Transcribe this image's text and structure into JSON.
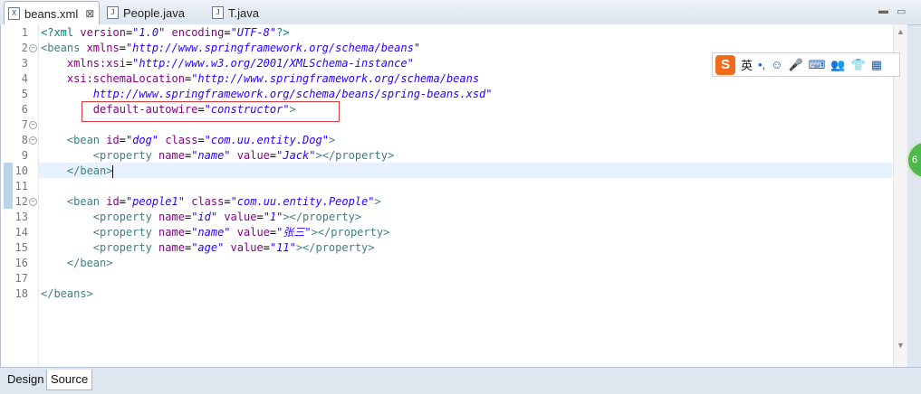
{
  "tabs": [
    {
      "label": "beans.xml",
      "icon": "xml-file-icon",
      "glyph": "X",
      "active": true
    },
    {
      "label": "People.java",
      "icon": "java-file-icon",
      "glyph": "J",
      "active": false
    },
    {
      "label": "T.java",
      "icon": "java-file-icon",
      "glyph": "J",
      "active": false
    }
  ],
  "window_buttons": {
    "minimize": "▬",
    "maximize": "▭"
  },
  "editor": {
    "lines": [
      {
        "n": "1",
        "fold": ""
      },
      {
        "n": "2",
        "fold": "−"
      },
      {
        "n": "3",
        "fold": ""
      },
      {
        "n": "4",
        "fold": ""
      },
      {
        "n": "5",
        "fold": ""
      },
      {
        "n": "6",
        "fold": ""
      },
      {
        "n": "7",
        "fold": "−"
      },
      {
        "n": "8",
        "fold": "−"
      },
      {
        "n": "9",
        "fold": ""
      },
      {
        "n": "10",
        "fold": ""
      },
      {
        "n": "11",
        "fold": ""
      },
      {
        "n": "12",
        "fold": "−"
      },
      {
        "n": "13",
        "fold": ""
      },
      {
        "n": "14",
        "fold": ""
      },
      {
        "n": "15",
        "fold": ""
      },
      {
        "n": "16",
        "fold": ""
      },
      {
        "n": "17",
        "fold": ""
      },
      {
        "n": "18",
        "fold": ""
      }
    ],
    "code": {
      "l1": {
        "p1": "<?xml ",
        "a1": "version",
        "eq1": "=",
        "v1": "\"1.0\"",
        "sp": " ",
        "a2": "encoding",
        "eq2": "=",
        "v2": "\"UTF-8\"",
        "p2": "?>"
      },
      "l2": {
        "t1": "<beans ",
        "a1": "xmlns",
        "eq": "=",
        "v1": "\"http://www.springframework.org/schema/beans\""
      },
      "l3": {
        "indent": "    ",
        "a1": "xmlns:xsi",
        "eq": "=",
        "v1": "\"http://www.w3.org/2001/XMLSchema-instance\""
      },
      "l4": {
        "indent": "    ",
        "a1": "xsi:schemaLocation",
        "eq": "=",
        "v1": "\"http://www.springframework.org/schema/beans"
      },
      "l5": {
        "indent": "        ",
        "v1": "http://www.springframework.org/schema/beans/spring-beans.xsd\""
      },
      "l6": {
        "indent": "        ",
        "a1": "default-autowire",
        "eq": "=",
        "v1": "\"constructor\"",
        "t1": ">"
      },
      "l8": {
        "indent": "    ",
        "t1": "<bean ",
        "a1": "id",
        "eq1": "=",
        "v1": "\"dog\"",
        "sp": " ",
        "a2": "class",
        "eq2": "=",
        "v2": "\"com.uu.entity.Dog\"",
        "t2": ">"
      },
      "l9": {
        "indent": "        ",
        "t1": "<property ",
        "a1": "name",
        "eq1": "=",
        "v1": "\"name\"",
        "sp": " ",
        "a2": "value",
        "eq2": "=",
        "v2": "\"Jack\"",
        "t2": "></property>"
      },
      "l10": {
        "indent": "    ",
        "t1": "</bean>"
      },
      "l12": {
        "indent": "    ",
        "t1": "<bean ",
        "a1": "id",
        "eq1": "=",
        "v1": "\"people1\"",
        "sp": " ",
        "a2": "class",
        "eq2": "=",
        "v2": "\"com.uu.entity.People\"",
        "t2": ">"
      },
      "l13": {
        "indent": "        ",
        "t1": "<property ",
        "a1": "name",
        "eq1": "=",
        "v1": "\"id\"",
        "sp": " ",
        "a2": "value",
        "eq2": "=",
        "v2": "\"1\"",
        "t2": "></property>"
      },
      "l14": {
        "indent": "        ",
        "t1": "<property ",
        "a1": "name",
        "eq1": "=",
        "v1": "\"name\"",
        "sp": " ",
        "a2": "value",
        "eq2": "=",
        "v2": "\"张三\"",
        "t2": "></property>"
      },
      "l15": {
        "indent": "        ",
        "t1": "<property ",
        "a1": "name",
        "eq1": "=",
        "v1": "\"age\"",
        "sp": " ",
        "a2": "value",
        "eq2": "=",
        "v2": "\"11\"",
        "t2": "></property>"
      },
      "l16": {
        "indent": "    ",
        "t1": "</bean>"
      },
      "l18": {
        "t1": "</beans>"
      }
    }
  },
  "ime": {
    "logo": "S",
    "items": [
      "英",
      "•,",
      "☺",
      "🎤",
      "⌨",
      "👥",
      "👕",
      "▦"
    ]
  },
  "floating_badge": "6",
  "scroll": {
    "up": "▲",
    "down": "▼"
  },
  "bottom_tabs": [
    {
      "label": "Design",
      "active": false
    },
    {
      "label": "Source",
      "active": true
    }
  ],
  "colors": {
    "tag": "#3f7f7f",
    "attr": "#7f007f",
    "value": "#2a00ff",
    "highlight": "#e8f2fe",
    "red_box": "#d63a3a"
  }
}
